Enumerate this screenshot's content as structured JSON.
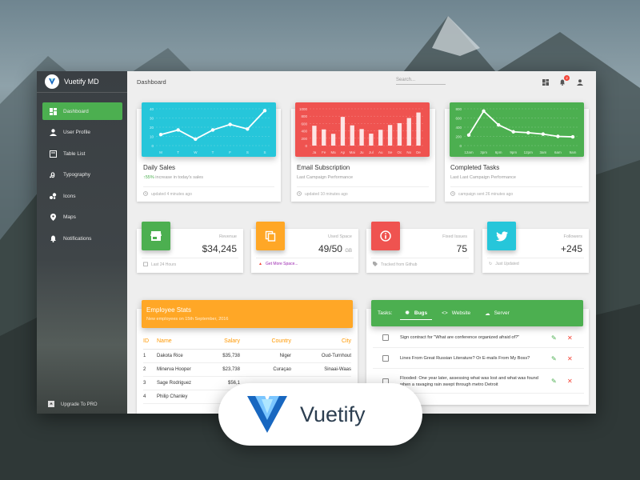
{
  "app": {
    "name": "Vuetify MD",
    "brand_overlay": "Vuetify"
  },
  "colors": {
    "green": "#4caf50",
    "cyan": "#26c6da",
    "red": "#ef5350",
    "orange": "#ffa726",
    "twitter": "#1da1f2",
    "sidebar": "#3a3f43"
  },
  "sidebar": {
    "items": [
      {
        "label": "Dashboard",
        "icon": "dashboard-icon",
        "active": true
      },
      {
        "label": "User Profile",
        "icon": "person-icon"
      },
      {
        "label": "Table List",
        "icon": "clipboard-icon"
      },
      {
        "label": "Typography",
        "icon": "text-format-icon"
      },
      {
        "label": "Icons",
        "icon": "bubble-chart-icon"
      },
      {
        "label": "Maps",
        "icon": "place-icon"
      },
      {
        "label": "Notifications",
        "icon": "bell-icon"
      }
    ],
    "footer": "Upgrade To PRO"
  },
  "topbar": {
    "title": "Dashboard",
    "search_placeholder": "Search...",
    "notification_count": "2"
  },
  "cards": [
    {
      "title": "Daily Sales",
      "sub_highlight": "55%",
      "sub_rest": " increase in today's sales",
      "footer": "updated 4 minutes ago"
    },
    {
      "title": "Email Subscription",
      "sub": "Last Campaign Performance",
      "footer": "updated 10 minutes ago"
    },
    {
      "title": "Completed Tasks",
      "sub": "Last Last Campaign Performance",
      "footer": "campaign sent 26 minutes ago"
    }
  ],
  "chart_data": [
    {
      "type": "line",
      "x": [
        "M",
        "T",
        "W",
        "T",
        "F",
        "S",
        "S"
      ],
      "values": [
        12,
        17,
        7,
        17,
        23,
        18,
        38
      ],
      "y_ticks": [
        "40",
        "30",
        "20",
        "10",
        "0"
      ],
      "ylim": [
        0,
        40
      ]
    },
    {
      "type": "bar",
      "categories": [
        "Ja",
        "Fe",
        "Ma",
        "Ap",
        "Mai",
        "Ju",
        "Jul",
        "Au",
        "Se",
        "Oc",
        "No",
        "De"
      ],
      "values": [
        540,
        440,
        320,
        780,
        550,
        450,
        325,
        430,
        560,
        610,
        750,
        900
      ],
      "y_ticks": [
        "1000",
        "800",
        "600",
        "400",
        "200",
        "0"
      ],
      "ylim": [
        0,
        1000
      ]
    },
    {
      "type": "line",
      "x": [
        "12am",
        "3pm",
        "6pm",
        "9pm",
        "12pm",
        "3am",
        "6am",
        "9am"
      ],
      "values": [
        230,
        750,
        450,
        300,
        280,
        250,
        200,
        190
      ],
      "y_ticks": [
        "800",
        "600",
        "400",
        "200",
        "0"
      ],
      "ylim": [
        0,
        800
      ]
    }
  ],
  "stats": [
    {
      "icon": "store-icon",
      "label": "Revenue",
      "value": "$34,245",
      "unit": "",
      "footer": "Last 24 Hours",
      "footer_icon": "calendar-icon"
    },
    {
      "icon": "content-copy-icon",
      "label": "Used Space",
      "value": "49/50",
      "unit": "GB",
      "footer": "Get More Space...",
      "footer_icon": "warning-icon"
    },
    {
      "icon": "info-icon",
      "label": "Fixed Issues",
      "value": "75",
      "unit": "",
      "footer": "Tracked from Github",
      "footer_icon": "tag-icon"
    },
    {
      "icon": "twitter-icon",
      "label": "Followers",
      "value": "+245",
      "unit": "",
      "footer": "Just Updated",
      "footer_icon": "refresh-icon"
    }
  ],
  "employees": {
    "title": "Employee Stats",
    "subtitle": "New employees on 15th September, 2016",
    "headers": [
      "ID",
      "Name",
      "Salary",
      "Country",
      "City"
    ],
    "rows": [
      [
        "1",
        "Dakota Rice",
        "$35,738",
        "Niger",
        "Oud-Turnhout"
      ],
      [
        "2",
        "Minerva Hooper",
        "$23,738",
        "Curaçao",
        "Sinaai-Waas"
      ],
      [
        "3",
        "Sage Rodriguez",
        "$56,1",
        "",
        ""
      ],
      [
        "4",
        "Philip Chanley",
        "",
        "",
        ""
      ]
    ]
  },
  "tasks": {
    "label": "Tasks:",
    "tabs": [
      {
        "label": "Bugs",
        "icon": "bug-icon",
        "active": true
      },
      {
        "label": "Website",
        "icon": "code-icon"
      },
      {
        "label": "Server",
        "icon": "cloud-icon"
      }
    ],
    "items": [
      "Sign contract for \"What are conference organized afraid of?\"",
      "Lines From Great Russian Literature? Or E-mails From My Boss?",
      "Flooded: One year later, assessing what was lost and what was found when a ravaging rain swept through metro Detroit"
    ]
  }
}
